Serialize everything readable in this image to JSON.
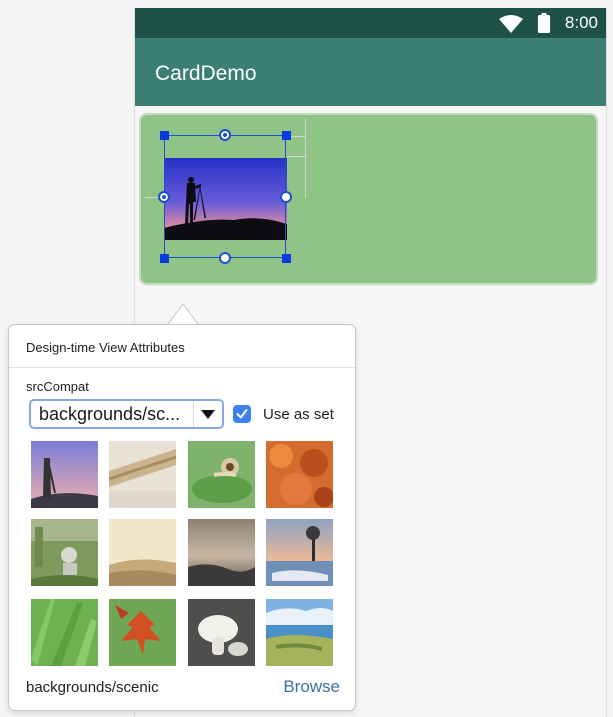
{
  "status_bar": {
    "time": "8:00",
    "wifi_icon": "wifi-icon",
    "battery_icon": "battery-icon"
  },
  "app_bar": {
    "title": "CardDemo"
  },
  "colors": {
    "status_bar": "#1f5247",
    "app_bar": "#3a7f72",
    "card": "#90c486",
    "selection": "#1d4ed8",
    "accent": "#3d82f0",
    "browse_link": "#3d6fa8"
  },
  "popup": {
    "title": "Design-time View Attributes",
    "attribute_label": "srcCompat",
    "dropdown_value": "backgrounds/sc...",
    "checkbox_label": "Use as set",
    "checkbox_checked": true,
    "thumbnails": [
      "scenic-photographer",
      "wood-closeup",
      "snail-leaf",
      "autumn-leaves",
      "robot-grass",
      "misty-hills",
      "cloudy-shore",
      "lake-sunset",
      "green-grass",
      "red-leaf",
      "mushroom",
      "coastal-landscape"
    ],
    "footer_label": "backgrounds/scenic",
    "browse_label": "Browse"
  }
}
